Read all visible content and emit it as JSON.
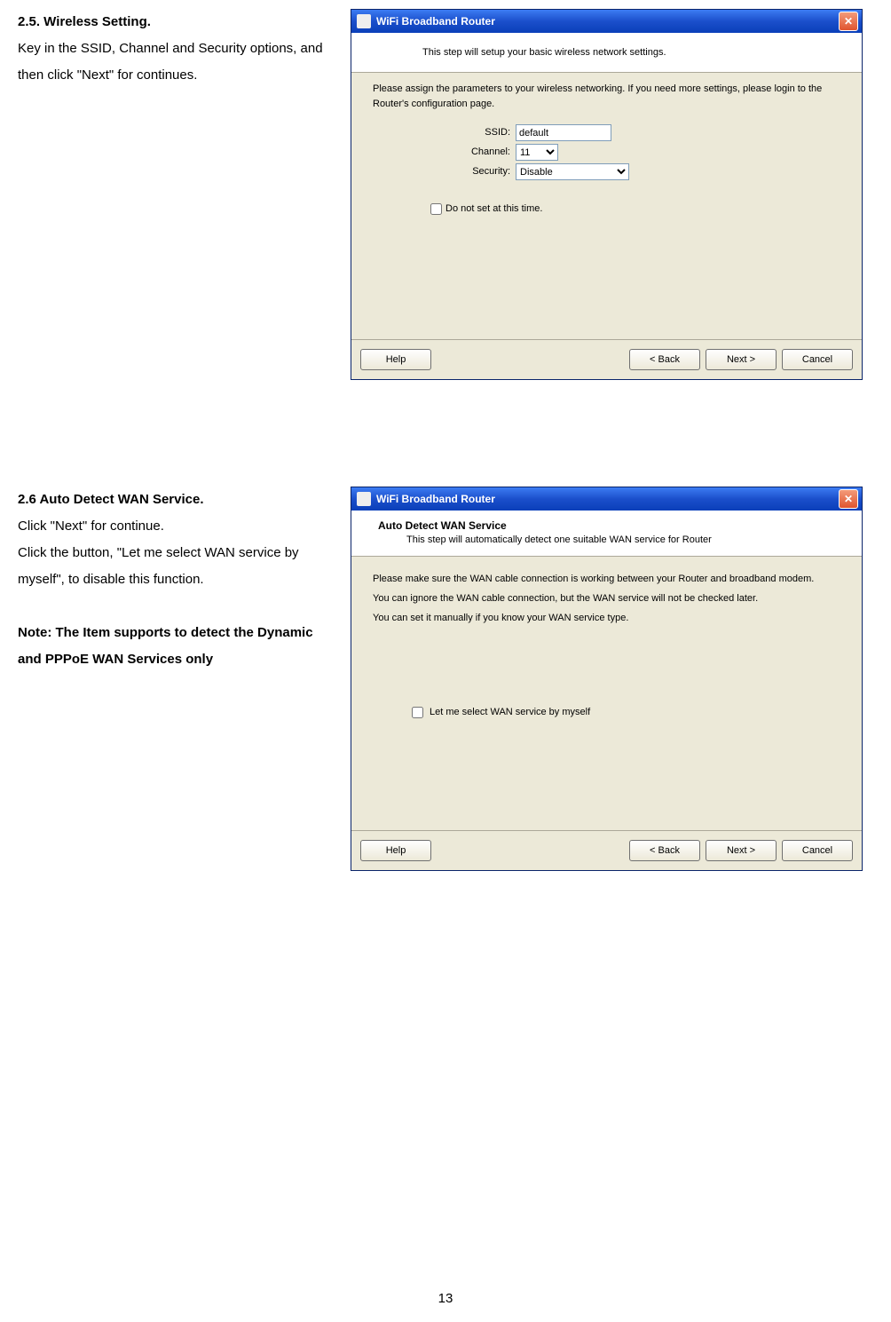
{
  "section25": {
    "heading": "2.5.  Wireless Setting.",
    "para": "Key in the SSID, Channel and Security options, and then click \"Next\" for continues."
  },
  "window1": {
    "title": "WiFi Broadband Router",
    "intro": "This step will setup your basic wireless network settings.",
    "instruction": "Please assign the parameters to your wireless networking. If you need more settings, please login to the Router's configuration page.",
    "ssid_label": "SSID:",
    "ssid_value": "default",
    "channel_label": "Channel:",
    "channel_value": "11",
    "security_label": "Security:",
    "security_value": "Disable",
    "checkbox": "Do not set at this time.",
    "help": "Help",
    "back": "< Back",
    "next": "Next >",
    "cancel": "Cancel"
  },
  "section26": {
    "heading": "2.6 Auto Detect WAN Service.",
    "para1": "Click \"Next\" for continue.",
    "para2": "Click the button, \"Let me select WAN service by myself\", to disable this function.",
    "note": "Note: The Item supports to detect the Dynamic and PPPoE WAN Services only"
  },
  "window2": {
    "title": "WiFi Broadband Router",
    "heading": "Auto Detect WAN Service",
    "sub": "This step will automatically detect one suitable WAN service for Router",
    "line1": "Please make sure the WAN cable connection is working between your Router and broadband modem.",
    "line2": "You can ignore the WAN cable connection, but the WAN service will not be checked later.",
    "line3": "You can set it manually if you know your WAN service type.",
    "checkbox": "Let me select WAN service by myself",
    "help": "Help",
    "back": "< Back",
    "next": "Next >",
    "cancel": "Cancel"
  },
  "page_number": "13"
}
